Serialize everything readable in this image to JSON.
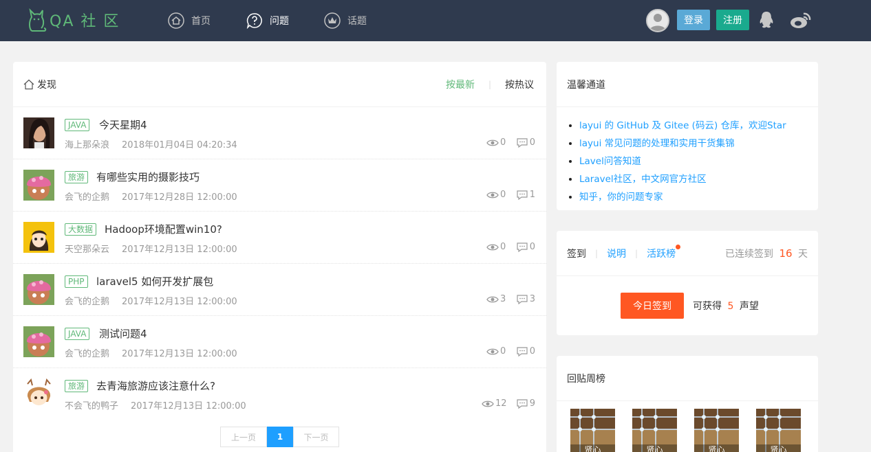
{
  "header": {
    "logo_text": "QA 社 区",
    "nav": [
      {
        "label": "首页",
        "icon": "home-icon"
      },
      {
        "label": "问题",
        "icon": "question-icon"
      },
      {
        "label": "话题",
        "icon": "crown-icon"
      }
    ],
    "login_label": "登录",
    "register_label": "注册"
  },
  "main": {
    "title": "发现",
    "sort_newest": "按最新",
    "sort_hot": "按热议",
    "items": [
      {
        "tag": "JAVA",
        "title": "今天星期4",
        "author": "海上那朵浪",
        "time": "2018年01月04日 04:20:34",
        "views": "0",
        "comments": "0"
      },
      {
        "tag": "旅游",
        "title": "有哪些实用的摄影技巧",
        "author": "会飞的企鹅",
        "time": "2017年12月28日 12:00:00",
        "views": "0",
        "comments": "1"
      },
      {
        "tag": "大数据",
        "title": "Hadoop环境配置win10?",
        "author": "天空那朵云",
        "time": "2017年12月13日 12:00:00",
        "views": "0",
        "comments": "0"
      },
      {
        "tag": "PHP",
        "title": "laravel5 如何开发扩展包",
        "author": "会飞的企鹅",
        "time": "2017年12月13日 12:00:00",
        "views": "3",
        "comments": "3"
      },
      {
        "tag": "JAVA",
        "title": "测试问题4",
        "author": "会飞的企鹅",
        "time": "2017年12月13日 12:00:00",
        "views": "0",
        "comments": "0"
      },
      {
        "tag": "旅游",
        "title": "去青海旅游应该注意什么?",
        "author": "不会飞的鸭子",
        "time": "2017年12月13日 12:00:00",
        "views": "12",
        "comments": "9"
      }
    ],
    "pager": {
      "prev": "上一页",
      "current": "1",
      "next": "下一页"
    }
  },
  "side_links": {
    "title": "温馨通道",
    "links": [
      "layui 的 GitHub 及 Gitee (码云) 仓库，欢迎Star",
      "layui 常见问题的处理和实用干货集锦",
      "Lavel问答知道",
      "Laravel社区，中文网官方社区",
      "知乎，你的问题专家"
    ]
  },
  "sign": {
    "tab_sign": "签到",
    "tab_explain": "说明",
    "tab_active": "活跃榜",
    "days_prefix": "已连续签到",
    "days_count": "16",
    "days_suffix": "天",
    "button": "今日签到",
    "reward_prefix": "可获得",
    "reward_count": "5",
    "reward_suffix": "声望"
  },
  "reply_rank": {
    "title": "回贴周榜",
    "users": [
      "贤心",
      "贤心",
      "贤心",
      "贤心"
    ]
  },
  "colors": {
    "accent_green": "#5fb878",
    "header_bg": "#2f3a4e",
    "link_blue": "#1e9fff",
    "orange": "#ff5722"
  }
}
